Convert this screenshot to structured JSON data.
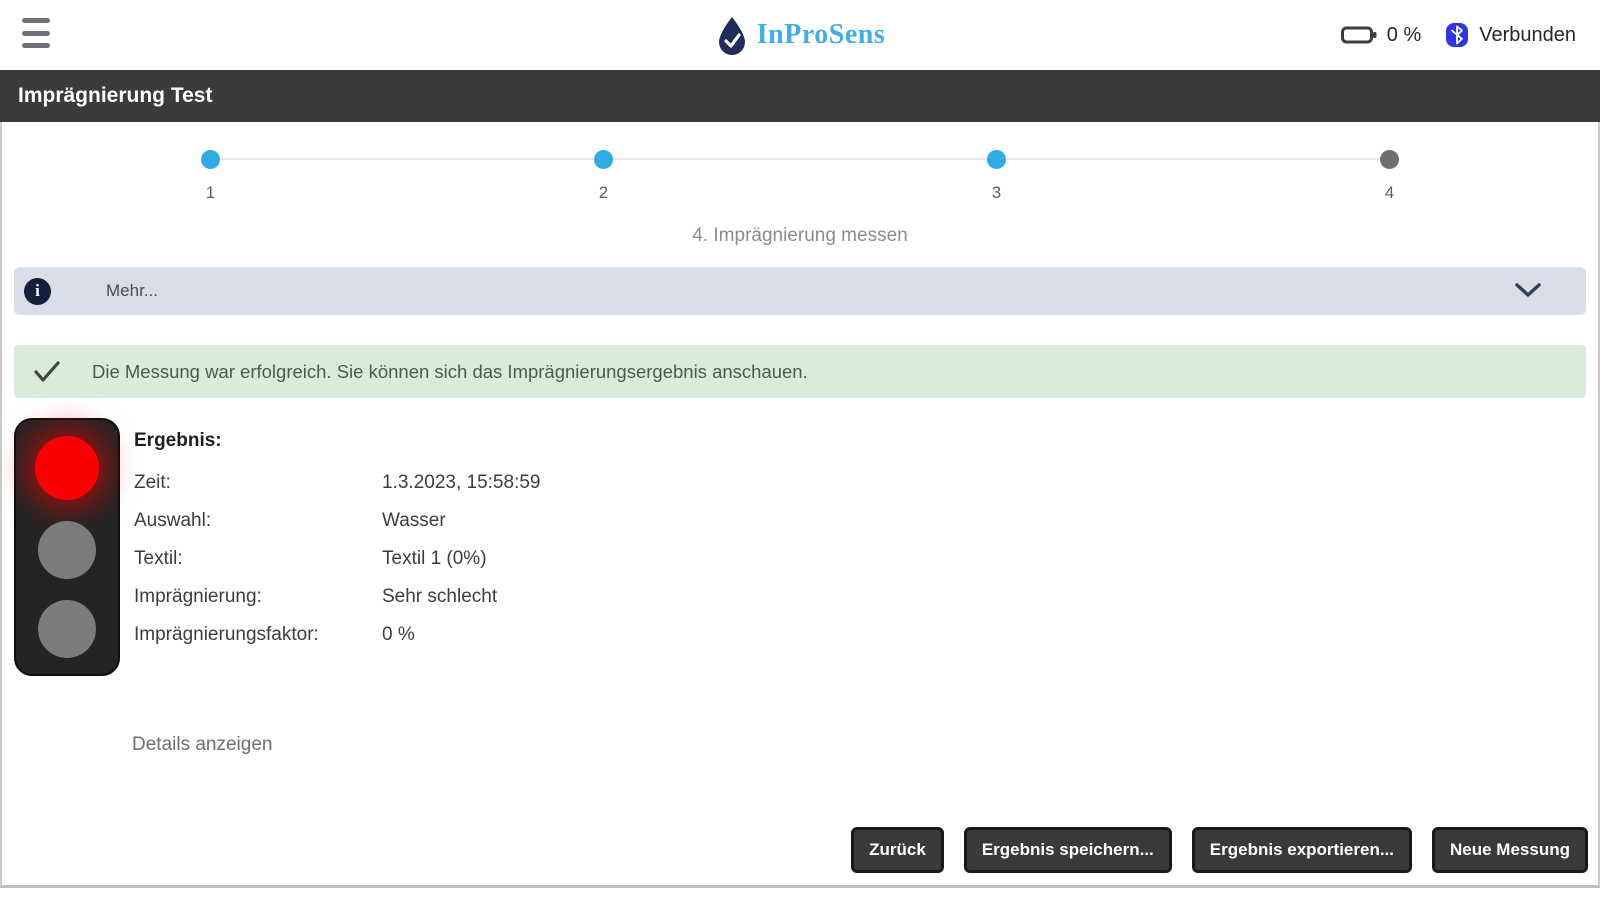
{
  "topbar": {
    "brand": "InProSens",
    "battery_percent": "0 %",
    "bluetooth_label": "Verbunden"
  },
  "titlebar": {
    "title": "Imprägnierung Test"
  },
  "stepper": {
    "steps": [
      {
        "label": "1",
        "state": "done"
      },
      {
        "label": "2",
        "state": "done"
      },
      {
        "label": "3",
        "state": "done"
      },
      {
        "label": "4",
        "state": "current"
      }
    ],
    "current_label": "4. Imprägnierung messen"
  },
  "accordion": {
    "label": "Mehr..."
  },
  "alert": {
    "message": "Die Messung war erfolgreich. Sie können sich das Imprägnierungsergebnis anschauen."
  },
  "result": {
    "heading": "Ergebnis:",
    "rows": [
      {
        "label": "Zeit:",
        "value": "1.3.2023, 15:58:59"
      },
      {
        "label": "Auswahl:",
        "value": "Wasser"
      },
      {
        "label": "Textil:",
        "value": "Textil 1 (0%)"
      },
      {
        "label": "Imprägnierung:",
        "value": "Sehr schlecht"
      },
      {
        "label": "Imprägnierungsfaktor:",
        "value": "0 %"
      }
    ],
    "traffic_light_state": "red",
    "details_link": "Details anzeigen"
  },
  "footer": {
    "buttons": [
      {
        "label": "Zurück"
      },
      {
        "label": "Ergebnis speichern..."
      },
      {
        "label": "Ergebnis exportieren..."
      },
      {
        "label": "Neue Messung"
      }
    ]
  },
  "colors": {
    "accent_blue": "#30ace2",
    "brand_blue": "#42aee4",
    "step_inactive_gray": "#6f6f6f",
    "accordion_bg": "#d9dde7",
    "alert_green_bg": "#d9ecd9",
    "titlebar_bg": "#3b3b3b",
    "button_bg": "#3a3a3a",
    "traffic_red": "#fb0000",
    "bluetooth_blue": "#2d35e6"
  }
}
